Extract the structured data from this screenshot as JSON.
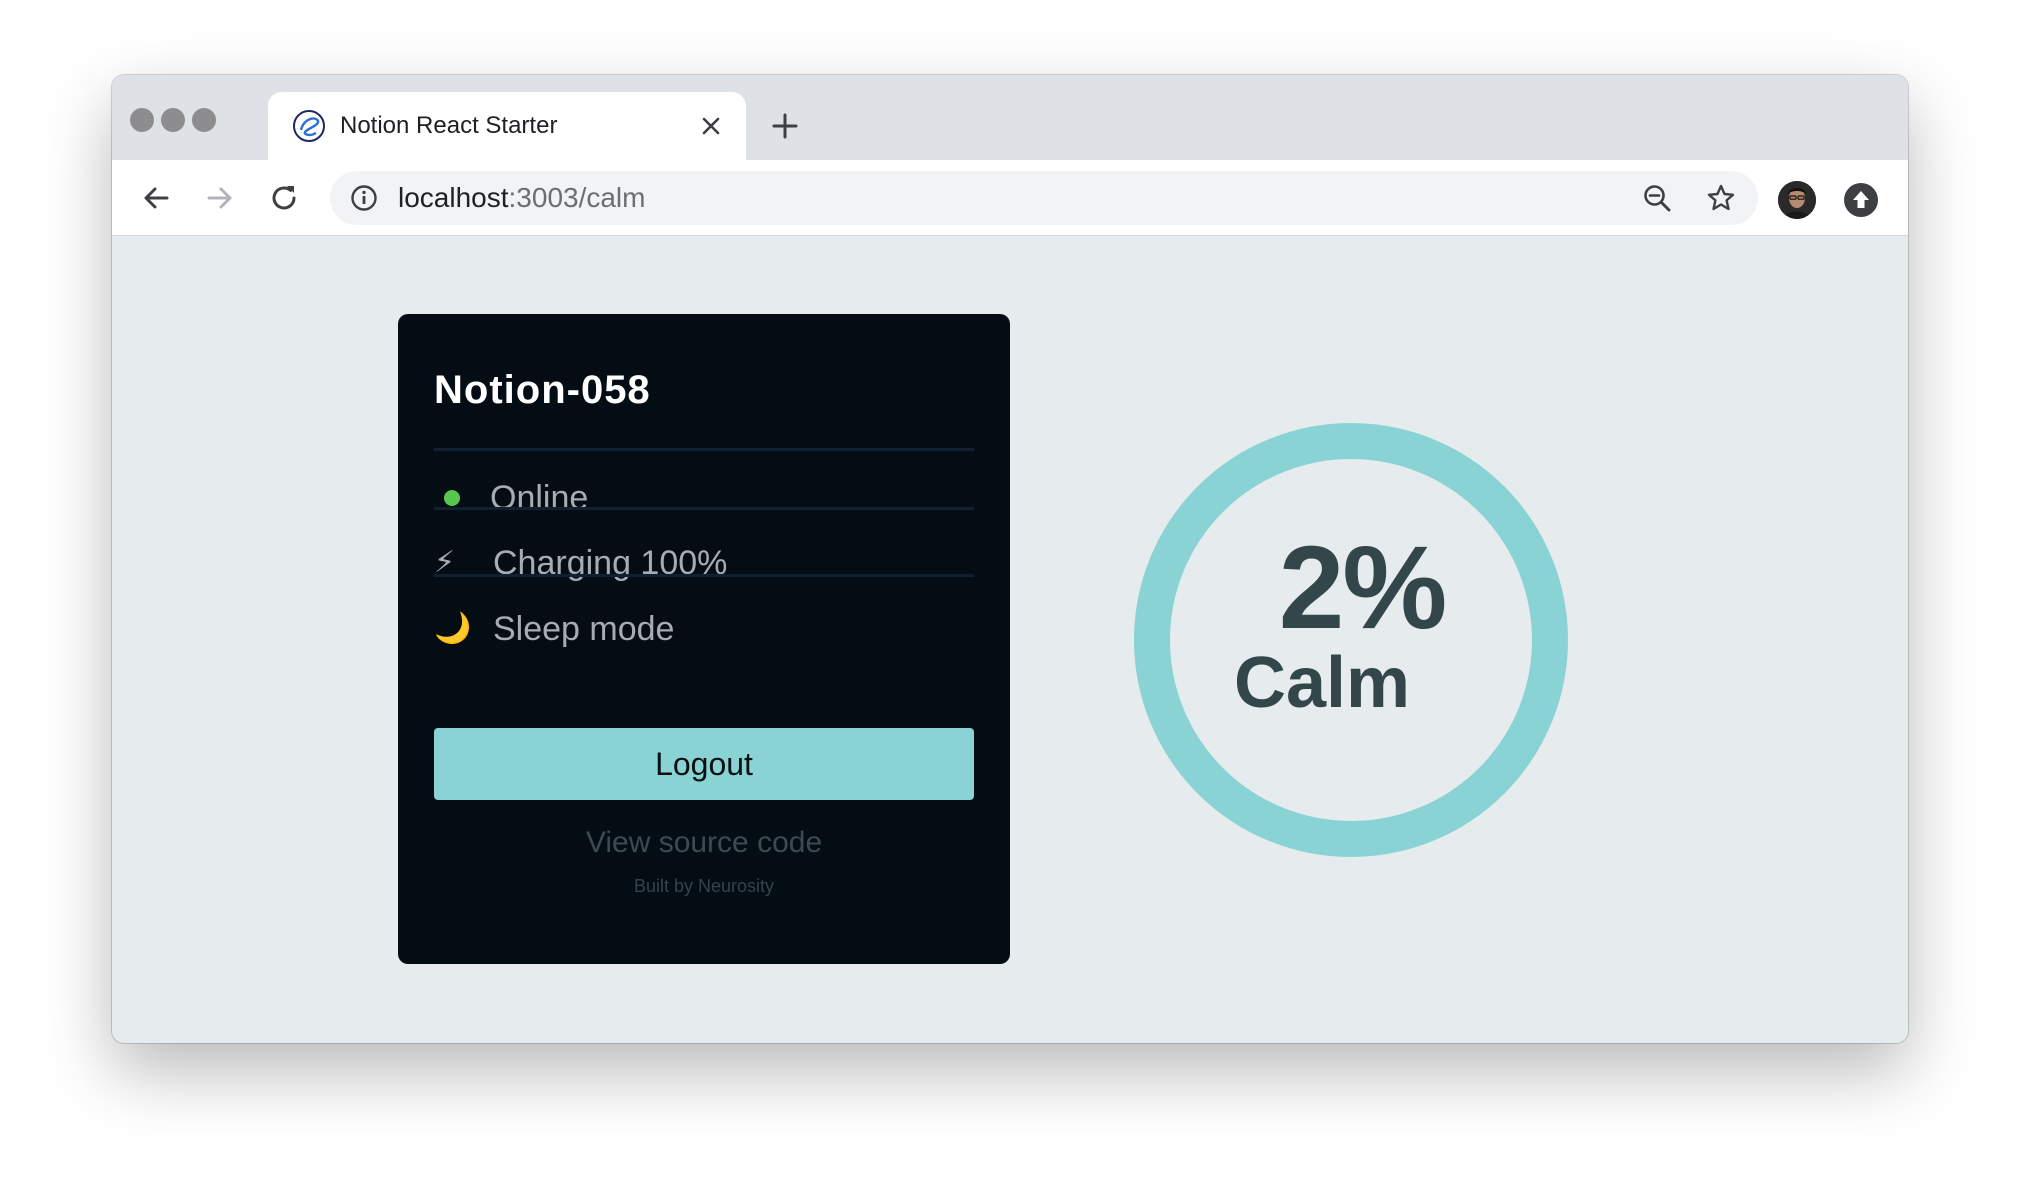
{
  "browser": {
    "tab_title": "Notion React Starter",
    "url_host": "localhost",
    "url_path": ":3003/calm"
  },
  "icons": {
    "back": "arrow-left-icon",
    "forward": "arrow-right-icon",
    "reload": "reload-icon",
    "info": "info-icon",
    "zoom": "zoom-out-icon",
    "bookmark": "star-icon",
    "extension": "arrow-up-icon"
  },
  "device": {
    "name": "Notion-058",
    "status": "Online",
    "battery": "Charging 100%",
    "mode": "Sleep mode",
    "battery_icon": "⚡",
    "mode_icon": "🌙"
  },
  "actions": {
    "logout_label": "Logout",
    "source_link": "View source code",
    "built_by": "Built by Neurosity"
  },
  "metric": {
    "value": "2%",
    "label": "Calm",
    "fraction": 0.02
  },
  "colors": {
    "accent": "#89d3d4",
    "card_bg": "#050d14",
    "online": "#57c84d",
    "metric_text": "#33474b",
    "page_bg": "#e6ebee"
  }
}
